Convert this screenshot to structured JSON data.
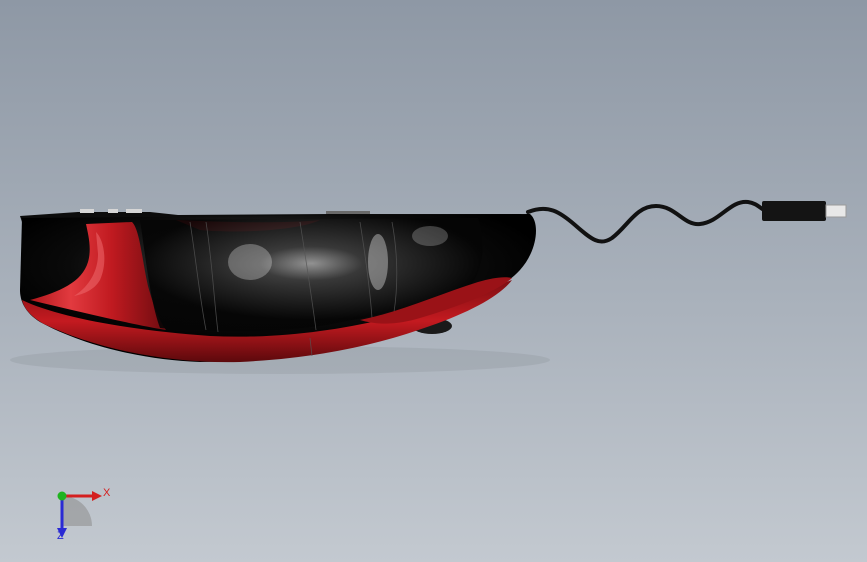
{
  "viewport": {
    "background_top": "#8e98a5",
    "background_bottom": "#c3c9d0"
  },
  "model": {
    "body_color": "#0b0b0b",
    "accent_color": "#c4161c",
    "cable_color": "#111111",
    "plug_color": "#141414",
    "plug_tip_color": "#e8e8e8"
  },
  "triad": {
    "x_label": "X",
    "z_label": "Z",
    "x_color": "#d41f1f",
    "y_color": "#1fb31f",
    "z_color": "#2a2ad4"
  }
}
